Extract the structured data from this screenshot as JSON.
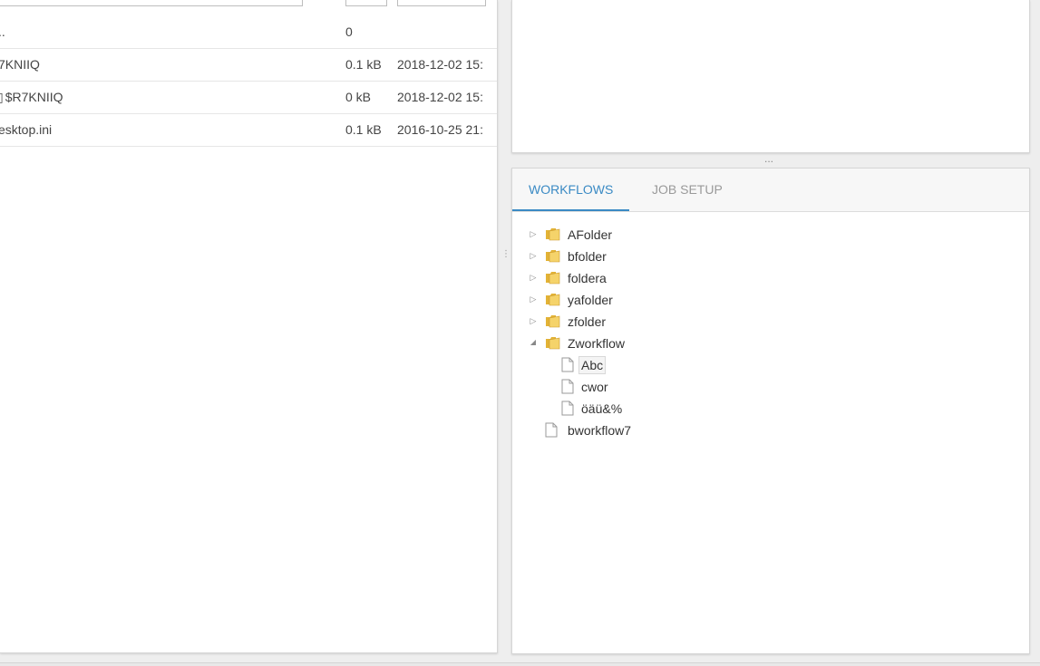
{
  "files": [
    {
      "name": "..",
      "prefix": "",
      "size": "0",
      "date": ""
    },
    {
      "name": "7KNIIQ",
      "prefix": "",
      "size": "0.1 kB",
      "date": "2018-12-02 15:"
    },
    {
      "name": "$R7KNIIQ",
      "prefix": "",
      "size": "0 kB",
      "date": "2018-12-02 15:"
    },
    {
      "name": "esktop.ini",
      "prefix": "",
      "size": "0.1 kB",
      "date": "2016-10-25 21:"
    }
  ],
  "tabs": {
    "workflows": "WORKFLOWS",
    "job_setup": "JOB SETUP",
    "active": "workflows"
  },
  "tree": {
    "folders": [
      {
        "label": "AFolder",
        "expanded": false
      },
      {
        "label": "bfolder",
        "expanded": false
      },
      {
        "label": "foldera",
        "expanded": false
      },
      {
        "label": "yafolder",
        "expanded": false
      },
      {
        "label": "zfolder",
        "expanded": false
      },
      {
        "label": "Zworkflow",
        "expanded": true
      }
    ],
    "zworkflow_children": [
      {
        "label": "Abc",
        "selected": true
      },
      {
        "label": "cwor",
        "selected": false
      },
      {
        "label": "öäü&%",
        "selected": false
      }
    ],
    "root_file": {
      "label": "bworkflow7"
    }
  },
  "colors": {
    "accent": "#3a8ac4",
    "folder": "#e8b92e",
    "tab_inactive": "#9a9a9a"
  },
  "splitter_glyph": "..."
}
